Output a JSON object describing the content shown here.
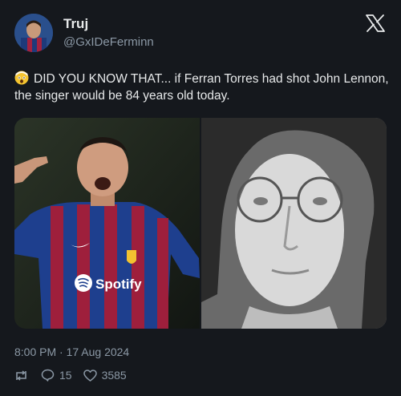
{
  "author": {
    "name": "Truj",
    "handle": "@GxIDeFerminn"
  },
  "tweet": {
    "emoji": "shocked-face-emoji",
    "text": "DID YOU KNOW THAT... if Ferran Torres had shot John Lennon, the singer would be 84 years old today."
  },
  "media": {
    "left": {
      "jersey_sponsor": "Spotify"
    },
    "right": {}
  },
  "meta": {
    "timestamp": "8:00 PM · 17 Aug 2024"
  },
  "stats": {
    "replies": "15",
    "likes": "3585"
  },
  "colors": {
    "background": "#15181d",
    "text": "#e7e9ea",
    "secondary_text": "#8b98a5",
    "barca_blue": "#1e4f9e",
    "barca_red": "#9e1f3c"
  }
}
